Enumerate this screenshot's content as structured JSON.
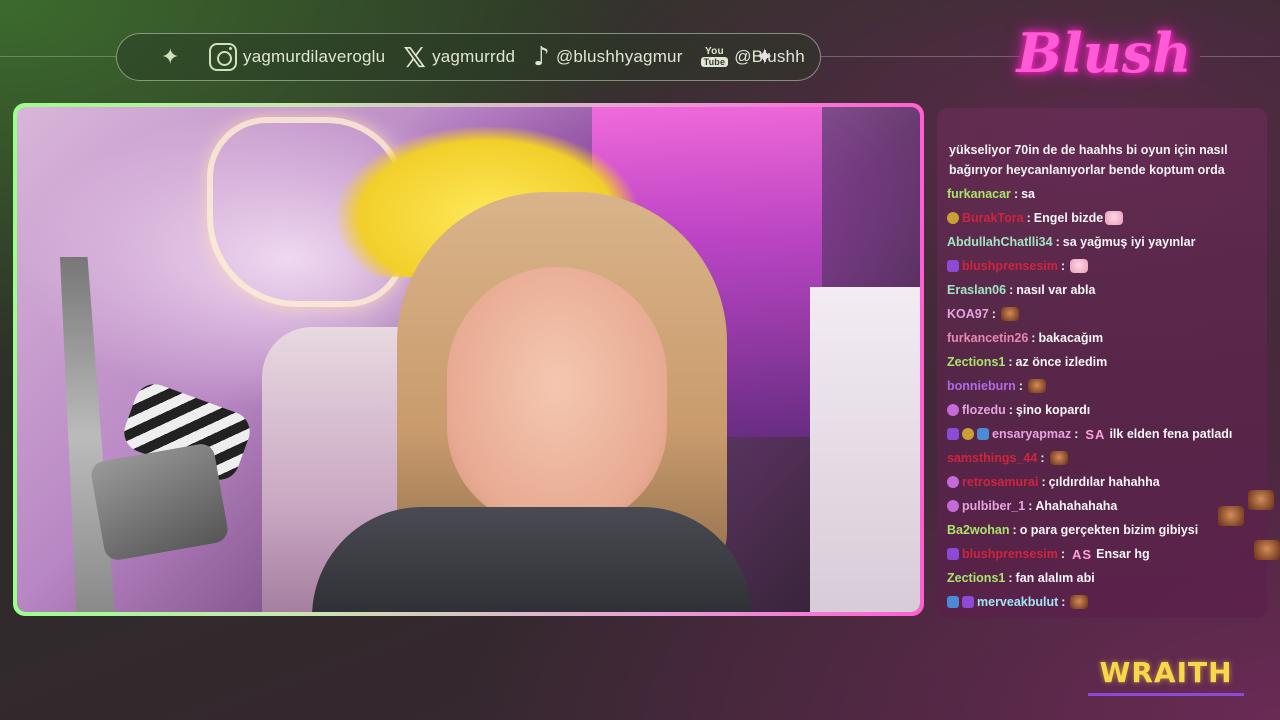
{
  "social": {
    "instagram": "yagmurdilaveroglu",
    "x": "yagmurrdd",
    "tiktok": "@blushhyagmur",
    "youtube": "@Blushh",
    "youtube_icon_top": "You",
    "youtube_icon_bottom": "Tube"
  },
  "brand": {
    "logo_text": "Blush",
    "sponsor": "WRAITH"
  },
  "chat": {
    "continuation": "yükseliyor 70in de de haahhs bi oyun için nasıl bağırıyor heycanlanıyorlar bende koptum orda",
    "messages": [
      {
        "user": "furkanacar",
        "color": "#a8e46a",
        "badges": [],
        "text": "sa",
        "emote": ""
      },
      {
        "user": "BurakTora",
        "color": "#d0243c",
        "badges": [
          "bits"
        ],
        "text": "Engel bizde",
        "emote": "pink"
      },
      {
        "user": "AbdullahChatlli34",
        "color": "#9fe6c0",
        "badges": [],
        "text": "sa yağmuş iyi yayınlar",
        "emote": ""
      },
      {
        "user": "blushprensesim",
        "color": "#d0243c",
        "badges": [
          "sub"
        ],
        "text": "",
        "emote": "pink"
      },
      {
        "user": "Eraslan06",
        "color": "#9fe6c0",
        "badges": [],
        "text": "nasıl var abla",
        "emote": ""
      },
      {
        "user": "KOA97",
        "color": "#e6a3e0",
        "badges": [],
        "text": "",
        "emote": "brown"
      },
      {
        "user": "furkancetin26",
        "color": "#e688b0",
        "badges": [],
        "text": "bakacağım",
        "emote": ""
      },
      {
        "user": "Zections1",
        "color": "#a8e46a",
        "badges": [],
        "text": "az önce izledim",
        "emote": ""
      },
      {
        "user": "bonnieburn",
        "color": "#b06ae6",
        "badges": [],
        "text": "",
        "emote": "brown"
      },
      {
        "user": "flozedu",
        "color": "#e6a3e0",
        "badges": [
          "mod"
        ],
        "text": "şino kopardı",
        "emote": ""
      },
      {
        "user": "ensaryapmaz",
        "color": "#e6a3e0",
        "badges": [
          "sub",
          "bits",
          "vip"
        ],
        "text": "ilk elden fena patladı",
        "emote": "",
        "emote_text": "SA"
      },
      {
        "user": "samsthings_44",
        "color": "#d0243c",
        "badges": [],
        "text": "",
        "emote": "brown"
      },
      {
        "user": "retrosamurai",
        "color": "#d0243c",
        "badges": [
          "mod"
        ],
        "text": "çıldırdılar hahahha",
        "emote": ""
      },
      {
        "user": "pulbiber_1",
        "color": "#e6a3e0",
        "badges": [
          "mod"
        ],
        "text": "Ahahahahaha",
        "emote": ""
      },
      {
        "user": "Ba2wohan",
        "color": "#a8e46a",
        "badges": [],
        "text": "o para gerçekten bizim gibiysi",
        "emote": ""
      },
      {
        "user": "blushprensesim",
        "color": "#d0243c",
        "badges": [
          "sub"
        ],
        "text": "Ensar hg",
        "emote": "",
        "emote_text": "AS"
      },
      {
        "user": "Zections1",
        "color": "#a8e46a",
        "badges": [],
        "text": "fan alalım abi",
        "emote": ""
      },
      {
        "user": "merveakbulut",
        "color": "#9fe6f5",
        "badges": [
          "vip",
          "sub"
        ],
        "text": "",
        "emote": "brown"
      }
    ]
  },
  "colors": {
    "frame_green": "#9bff8c",
    "frame_pink": "#ff5fd0",
    "logo_pink": "#ff5bd6",
    "sponsor_yellow": "#f8d84a"
  }
}
